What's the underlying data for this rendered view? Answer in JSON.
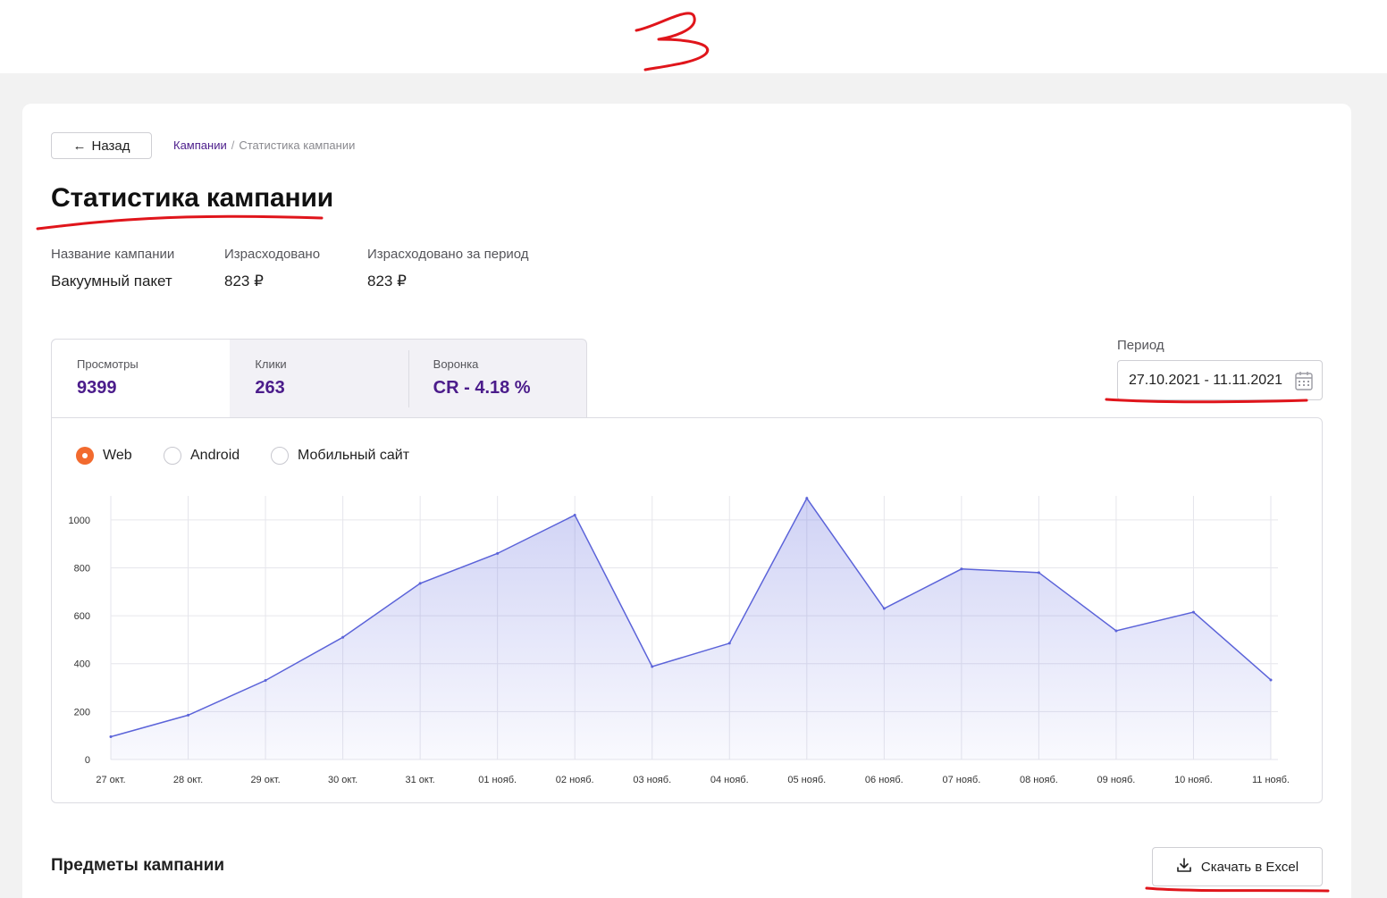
{
  "nav": {
    "back_label": "Назад"
  },
  "breadcrumb": {
    "link": "Кампании",
    "separator": "/",
    "current": "Статистика кампании"
  },
  "page": {
    "title": "Статистика кампании"
  },
  "summary": [
    {
      "label": "Название кампании",
      "value": "Вакуумный пакет"
    },
    {
      "label": "Израсходовано",
      "value": "823 ₽"
    },
    {
      "label": "Израсходовано за период",
      "value": "823 ₽"
    }
  ],
  "tabs": [
    {
      "label": "Просмотры",
      "value": "9399",
      "active": true
    },
    {
      "label": "Клики",
      "value": "263",
      "active": false
    },
    {
      "label": "Воронка",
      "value": "CR - 4.18 %",
      "active": false
    }
  ],
  "period": {
    "label": "Период",
    "value": "27.10.2021 - 11.11.2021",
    "icon": "calendar-icon"
  },
  "platforms": [
    {
      "label": "Web",
      "checked": true
    },
    {
      "label": "Android",
      "checked": false
    },
    {
      "label": "Мобильный сайт",
      "checked": false
    }
  ],
  "section": {
    "title": "Предметы кампании"
  },
  "export": {
    "label": "Скачать в Excel",
    "icon": "download-icon"
  },
  "colors": {
    "accent": "#4b1c8b",
    "radio": "#f26a2e",
    "line": "#5b63d9",
    "annotation": "#e0151b"
  },
  "chart_data": {
    "type": "area",
    "categories": [
      "27 окт.",
      "28 окт.",
      "29 окт.",
      "30 окт.",
      "31 окт.",
      "01 нояб.",
      "02 нояб.",
      "03 нояб.",
      "04 нояб.",
      "05 нояб.",
      "06 нояб.",
      "07 нояб.",
      "08 нояб.",
      "09 нояб.",
      "10 нояб.",
      "11 нояб."
    ],
    "values": [
      95,
      185,
      330,
      510,
      735,
      860,
      1020,
      388,
      485,
      1090,
      630,
      795,
      780,
      537,
      615,
      332
    ],
    "yticks": [
      0,
      200,
      400,
      600,
      800,
      1000
    ],
    "ylim": [
      0,
      1100
    ],
    "grid": true
  }
}
